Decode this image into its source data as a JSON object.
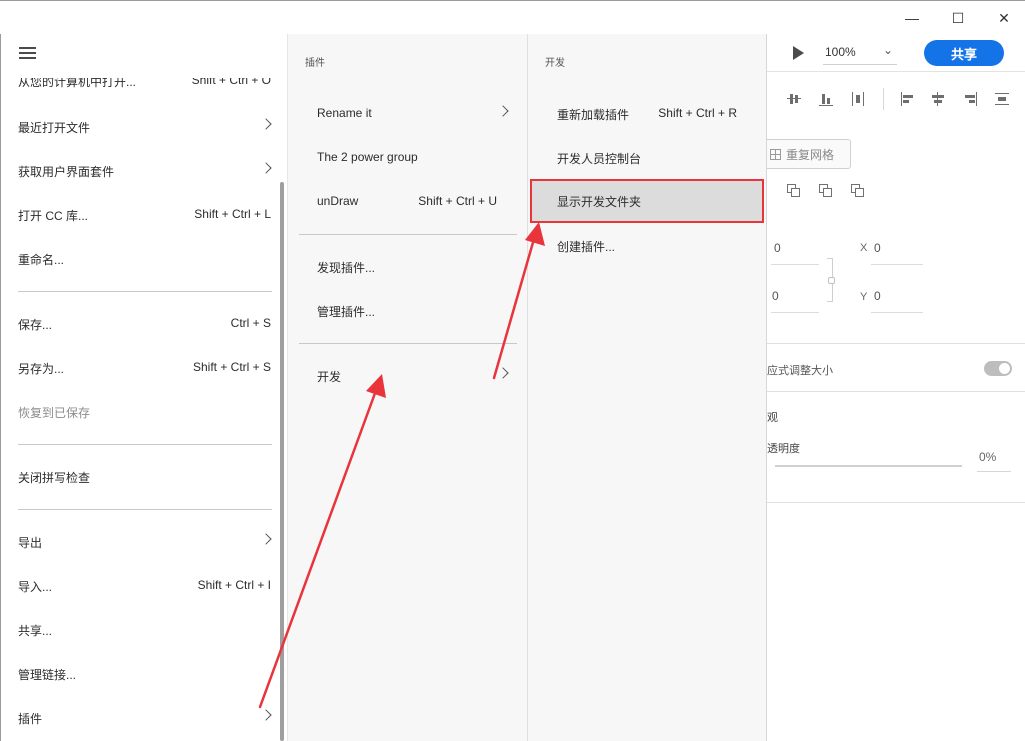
{
  "window": {
    "minimize_glyph": "—",
    "maximize_glyph": "☐",
    "close_glyph": "✕"
  },
  "toolbar": {
    "zoom": "100%",
    "share_label": "共享"
  },
  "properties": {
    "repeat_grid_label": "重复网格",
    "w_value": "0",
    "x_label": "X",
    "x_value": "0",
    "h_value": "0",
    "y_label": "Y",
    "y_value": "0",
    "responsive_label": "应式调整大小",
    "appearance_label": "观",
    "opacity_label": "透明度",
    "opacity_value": "0%"
  },
  "main_menu": {
    "items": [
      {
        "label": "从您的计算机中打开...",
        "shortcut": "Shift + Ctrl + O"
      },
      {
        "label": "最近打开文件"
      },
      {
        "label": "获取用户界面套件"
      },
      {
        "label": "打开 CC 库...",
        "shortcut": "Shift + Ctrl + L"
      },
      {
        "label": "重命名..."
      },
      {
        "label": "保存...",
        "shortcut": "Ctrl + S"
      },
      {
        "label": "另存为...",
        "shortcut": "Shift + Ctrl + S"
      },
      {
        "label": "恢复到已保存"
      },
      {
        "label": "关闭拼写检查"
      },
      {
        "label": "导出"
      },
      {
        "label": "导入...",
        "shortcut": "Shift + Ctrl + I"
      },
      {
        "label": "共享..."
      },
      {
        "label": "管理链接..."
      },
      {
        "label": "插件"
      }
    ]
  },
  "plugins_menu": {
    "header": "插件",
    "items": [
      {
        "label": "Rename it"
      },
      {
        "label": "The 2 power group"
      },
      {
        "label": "unDraw",
        "shortcut": "Shift + Ctrl + U"
      },
      {
        "label": "发现插件..."
      },
      {
        "label": "管理插件..."
      },
      {
        "label": "开发"
      }
    ]
  },
  "dev_menu": {
    "header": "开发",
    "items": [
      {
        "label": "重新加载插件",
        "shortcut": "Shift + Ctrl + R"
      },
      {
        "label": "开发人员控制台"
      },
      {
        "label": "显示开发文件夹"
      },
      {
        "label": "创建插件..."
      }
    ]
  },
  "colors": {
    "accent": "#1473e6",
    "annotation": "#e8343a",
    "highlight_bg": "#dcdcdc"
  }
}
